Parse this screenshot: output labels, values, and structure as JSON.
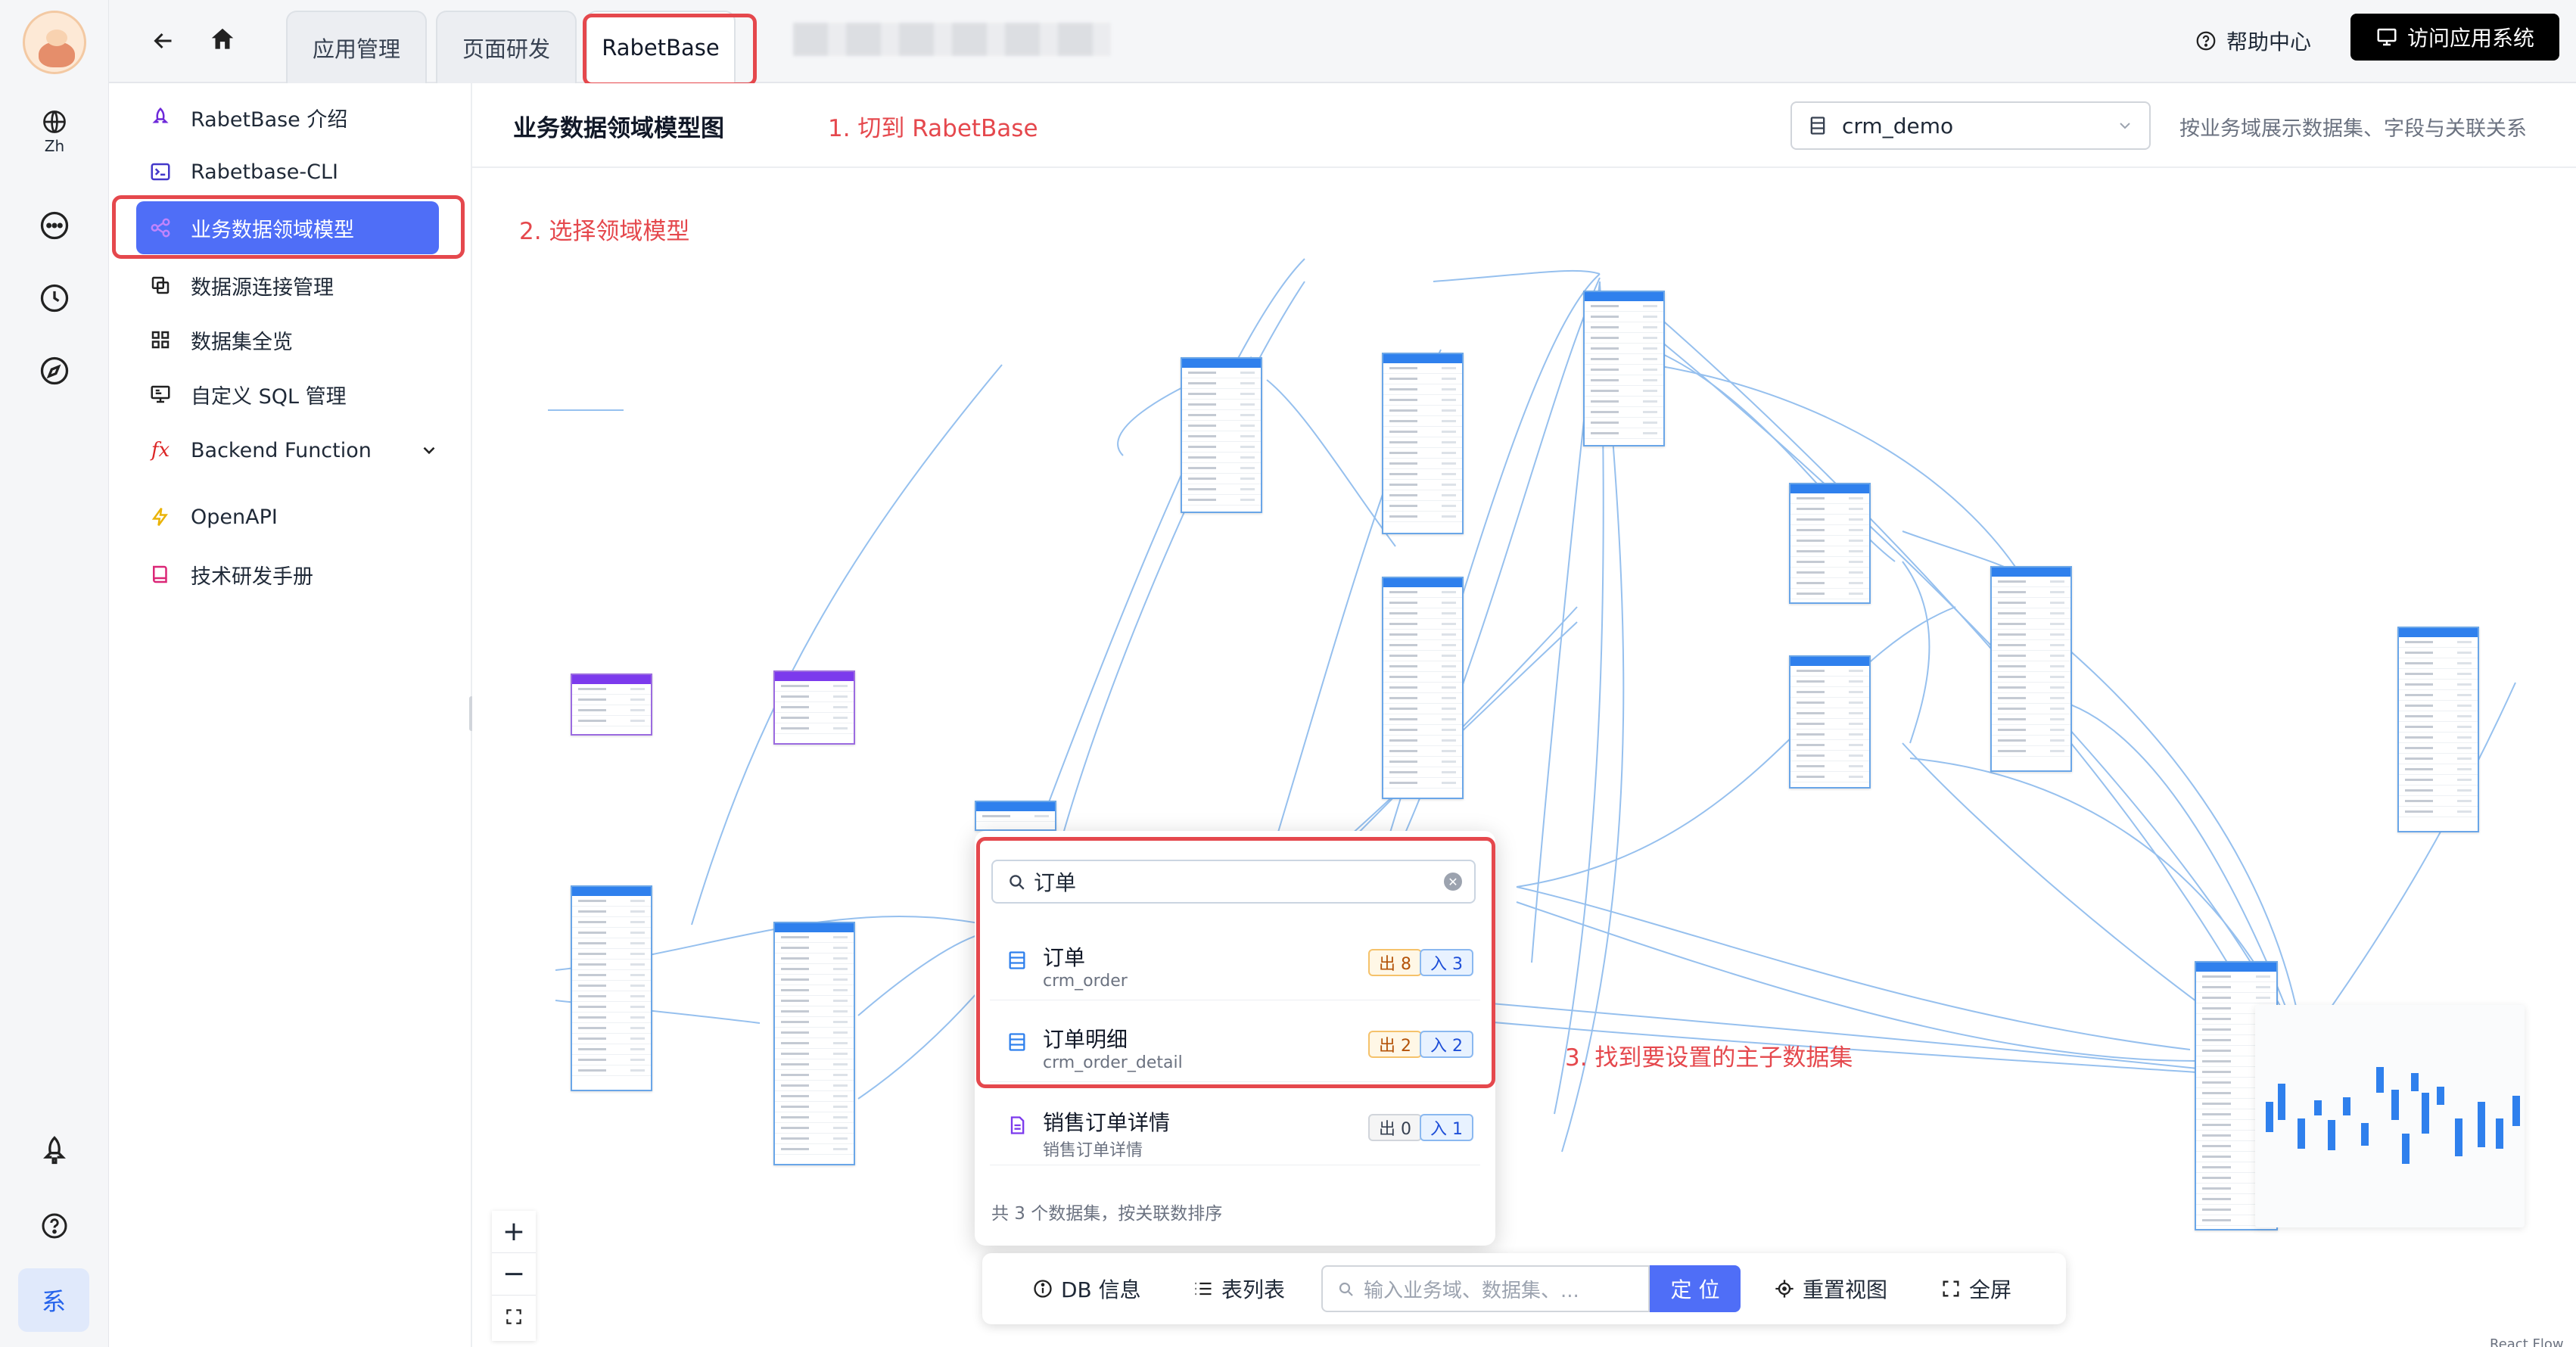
{
  "rail": {
    "lang_label": "Zh",
    "user_initial": "系"
  },
  "topbar": {
    "tabs": [
      "应用管理",
      "页面研发",
      "RabetBase"
    ],
    "help": "帮助中心",
    "visit": "访问应用系统"
  },
  "sidebar": {
    "items": [
      {
        "label": "RabetBase 介绍",
        "icon": "rocket-icon"
      },
      {
        "label": "Rabetbase-CLI",
        "icon": "terminal-icon"
      },
      {
        "label": "业务数据领域模型",
        "icon": "model-icon"
      },
      {
        "label": "数据源连接管理",
        "icon": "link-icon"
      },
      {
        "label": "数据集全览",
        "icon": "grid-icon"
      },
      {
        "label": "自定义 SQL 管理",
        "icon": "sql-icon"
      },
      {
        "label": "Backend Function",
        "icon": "fx-icon"
      },
      {
        "label": "OpenAPI",
        "icon": "bolt-icon"
      },
      {
        "label": "技术研发手册",
        "icon": "book-icon"
      }
    ]
  },
  "main": {
    "title": "业务数据领域模型图",
    "db_select": "crm_demo",
    "hint": "按业务域展示数据集、字段与关联关系"
  },
  "annotations": {
    "step1": "1. 切到 RabetBase",
    "step2": "2. 选择领域模型",
    "step3": "3. 找到要设置的主子数据集"
  },
  "search_popup": {
    "query": "订单",
    "results": [
      {
        "name": "订单",
        "sub": "crm_order",
        "out": "出 8",
        "in": "入 3"
      },
      {
        "name": "订单明细",
        "sub": "crm_order_detail",
        "out": "出 2",
        "in": "入 2"
      },
      {
        "name": "销售订单详情",
        "sub": "销售订单详情",
        "out": "出 0",
        "in": "入 1"
      }
    ],
    "footer": "共 3 个数据集，按关联数排序"
  },
  "toolbar": {
    "db_info": "DB 信息",
    "table_list": "表列表",
    "search_placeholder": "输入业务域、数据集、...",
    "locate": "定 位",
    "reset": "重置视图",
    "fullscreen": "全屏"
  },
  "zoom": {
    "plus": "+",
    "minus": "−"
  },
  "watermark": "React Flow",
  "colors": {
    "accent": "#4f6ef7",
    "annotation": "#e5484d",
    "table_header": "#2f80ed"
  }
}
